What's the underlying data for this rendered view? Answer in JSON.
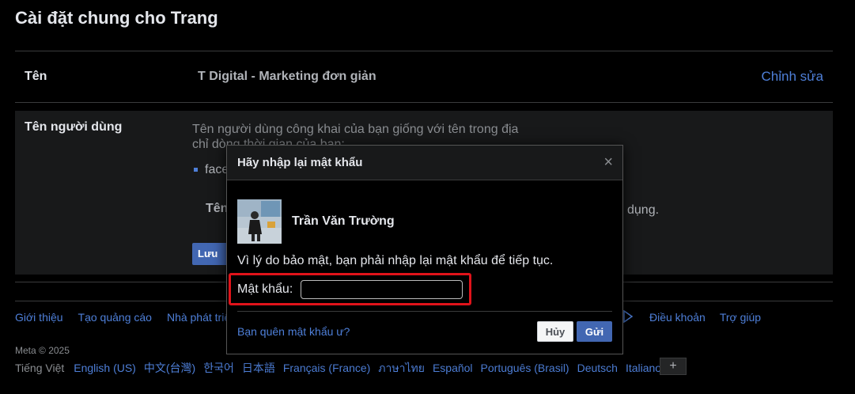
{
  "page": {
    "title": "Cài đặt chung cho Trang"
  },
  "name_row": {
    "label": "Tên",
    "value": "T Digital - Marketing đơn giản",
    "edit_label": "Chỉnh sửa"
  },
  "username_row": {
    "label": "Tên người dùng",
    "desc_line1": "Tên người dùng công khai của bạn giống với tên trong địa",
    "desc_line2": "chỉ dòng thời gian của bạn:",
    "bullet_text": "faceb",
    "note_text": "Tên",
    "note_end": "dụng.",
    "save_label": "Lưu thay đổi"
  },
  "footer": {
    "links": [
      "Giới thiệu",
      "Tạo quảng cáo",
      "Nhà phát triển"
    ],
    "links_right": [
      "Điều khoản",
      "Trợ giúp"
    ],
    "copyright": "Meta © 2025",
    "current_language": "Tiếng Việt",
    "languages": [
      "English (US)",
      "中文(台灣)",
      "한국어",
      "日本語",
      "Français (France)",
      "ภาษาไทย",
      "Español",
      "Português (Brasil)",
      "Deutsch",
      "Italiano"
    ],
    "more_languages_label": "+"
  },
  "dialog": {
    "title": "Hãy nhập lại mật khẩu",
    "close_icon": "×",
    "user_name": "Trần Văn Trường",
    "message": "Vì lý do bảo mật, bạn phải nhập lại mật khẩu để tiếp tục.",
    "password_label": "Mật khẩu:",
    "password_value": "",
    "forgot_label": "Bạn quên mật khẩu ư?",
    "cancel_label": "Hủy",
    "submit_label": "Gửi",
    "highlight_color": "#e0131a"
  },
  "colors": {
    "link": "#4e7fd8",
    "primary_button": "#4267b2",
    "background": "#000000"
  }
}
